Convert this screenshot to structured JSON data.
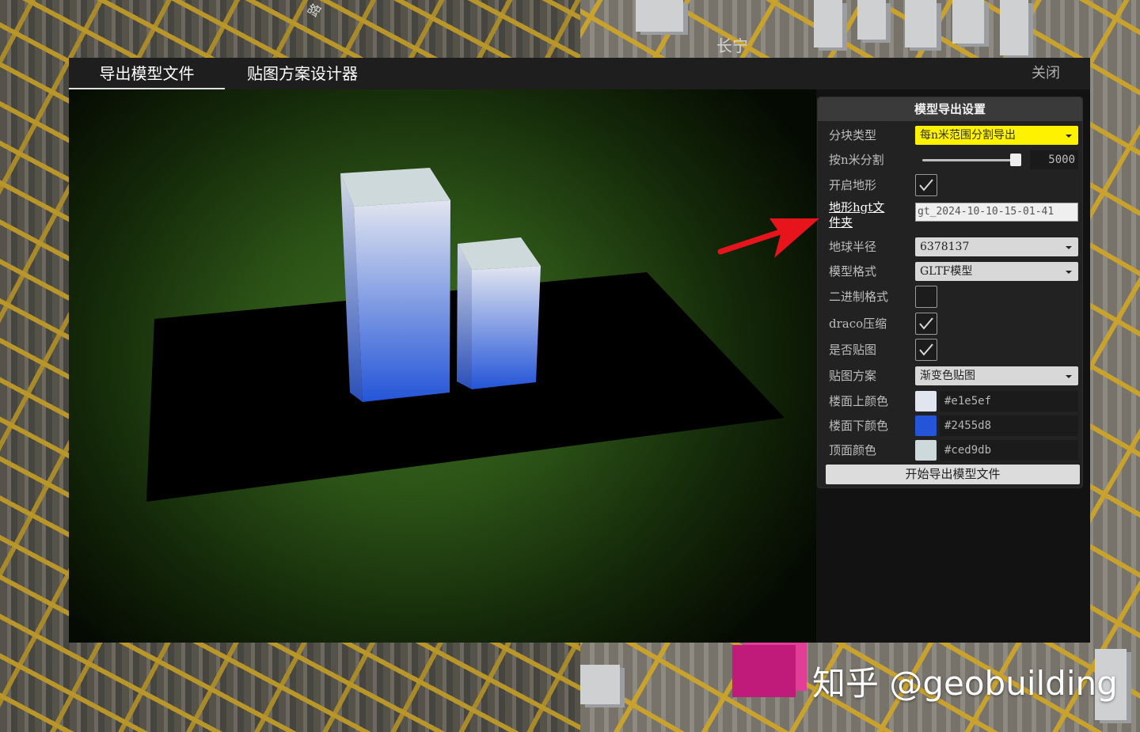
{
  "background": {
    "street_label": "长宁",
    "street_label_2": "路"
  },
  "dialog": {
    "tabs": [
      {
        "label": "导出模型文件",
        "active": true
      },
      {
        "label": "贴图方案设计器",
        "active": false
      }
    ],
    "close_label": "关闭"
  },
  "panel": {
    "title": "模型导出设置",
    "rows": {
      "split_type": {
        "label": "分块类型",
        "value": "每n米范围分割导出"
      },
      "split_distance": {
        "label": "按n米分割",
        "value": "5000",
        "slider_fraction": 0.95
      },
      "enable_terrain": {
        "label": "开启地形",
        "checked": true
      },
      "terrain_folder": {
        "label": "地形hgt文件夹",
        "value": "gt_2024-10-10-15-01-41"
      },
      "earth_radius": {
        "label": "地球半径",
        "value": "6378137"
      },
      "model_format": {
        "label": "模型格式",
        "value": "GLTF模型"
      },
      "binary_format": {
        "label": "二进制格式",
        "checked": false
      },
      "draco": {
        "label": "draco压缩",
        "checked": true
      },
      "apply_texture": {
        "label": "是否贴图",
        "checked": true
      },
      "texture_scheme": {
        "label": "贴图方案",
        "value": "渐变色贴图"
      },
      "floor_top_color": {
        "label": "楼面上颜色",
        "value": "#e1e5ef",
        "color": "#e1e5ef"
      },
      "floor_bottom_color": {
        "label": "楼面下颜色",
        "value": "#2455d8",
        "color": "#2455d8"
      },
      "roof_color": {
        "label": "顶面颜色",
        "value": "#ced9db",
        "color": "#ced9db"
      }
    },
    "export_button": "开始导出模型文件"
  },
  "colors": {
    "accent_yellow": "#fff200",
    "arrow": "#e8141c",
    "building_top": "#e1e5ef",
    "building_bottom": "#2455d8",
    "building_roof": "#ced9db"
  },
  "watermark": "知乎 @geobuilding"
}
